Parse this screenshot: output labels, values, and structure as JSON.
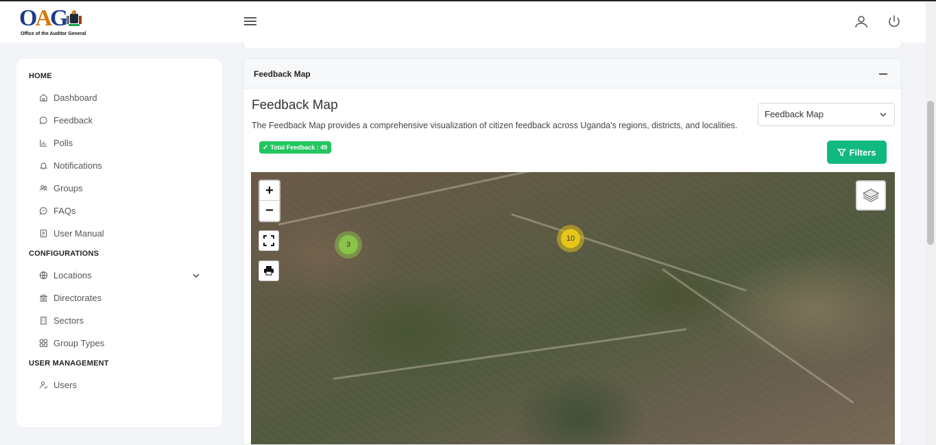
{
  "header": {
    "logo_text": "OAG",
    "logo_subtitle": "Office of the Auditor General",
    "menu_icon": "hamburger-icon",
    "user_icon": "user-icon",
    "power_icon": "power-icon"
  },
  "sidebar": {
    "sections": [
      {
        "title": "HOME",
        "items": [
          {
            "label": "Dashboard",
            "icon": "home-icon"
          },
          {
            "label": "Feedback",
            "icon": "chat-icon"
          },
          {
            "label": "Polls",
            "icon": "bar-chart-icon"
          },
          {
            "label": "Notifications",
            "icon": "bell-icon"
          },
          {
            "label": "Groups",
            "icon": "users-icon"
          },
          {
            "label": "FAQs",
            "icon": "question-chat-icon"
          },
          {
            "label": "User Manual",
            "icon": "book-icon"
          }
        ]
      },
      {
        "title": "CONFIGURATIONS",
        "items": [
          {
            "label": "Locations",
            "icon": "globe-icon"
          },
          {
            "label": "Directorates",
            "icon": "bank-icon"
          },
          {
            "label": "Sectors",
            "icon": "building-icon"
          },
          {
            "label": "Group Types",
            "icon": "grid-icon"
          }
        ]
      },
      {
        "title": "USER MANAGEMENT",
        "items": [
          {
            "label": "Users",
            "icon": "user-check-icon"
          }
        ]
      }
    ]
  },
  "card": {
    "header_title": "Feedback Map",
    "title": "Feedback Map",
    "description": "The Feedback Map provides a comprehensive visualization of citizen feedback across Uganda's regions, districts, and localities.",
    "select_value": "Feedback Map",
    "badge": "Total Feedback : 49",
    "filters_label": "Filters"
  },
  "map": {
    "zoom_in": "+",
    "zoom_out": "−",
    "clusters": [
      {
        "count": "3",
        "color": "#8bc34a"
      },
      {
        "count": "10",
        "color": "#e6c619"
      }
    ]
  }
}
